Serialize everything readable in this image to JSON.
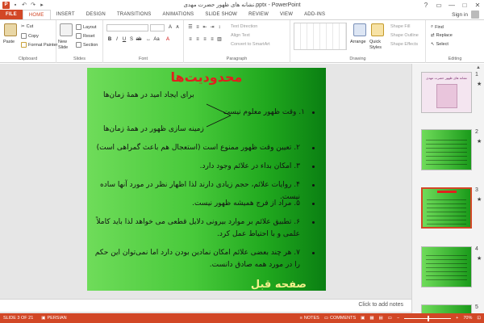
{
  "window": {
    "title": "نشانه های ظهور حضرت مهدی.pptx - PowerPoint",
    "controls": [
      "?",
      "▭",
      "—",
      "□",
      "✕"
    ]
  },
  "tabs": [
    {
      "label": "FILE"
    },
    {
      "label": "HOME"
    },
    {
      "label": "INSERT"
    },
    {
      "label": "DESIGN"
    },
    {
      "label": "TRANSITIONS"
    },
    {
      "label": "ANIMATIONS"
    },
    {
      "label": "SLIDE SHOW"
    },
    {
      "label": "REVIEW"
    },
    {
      "label": "VIEW"
    },
    {
      "label": "ADD-INS"
    }
  ],
  "user": {
    "name": "Sign in"
  },
  "ribbon": {
    "clipboard": {
      "label": "Clipboard",
      "paste": "Paste",
      "cut": "Cut",
      "copy": "Copy",
      "format_painter": "Format Painter"
    },
    "slides": {
      "label": "Slides",
      "new_slide": "New Slide",
      "layout": "Layout",
      "reset": "Reset",
      "section": "Section"
    },
    "font": {
      "label": "Font"
    },
    "paragraph": {
      "label": "Paragraph",
      "text_direction": "Text Direction",
      "align_text": "Align Text",
      "convert": "Convert to SmartArt"
    },
    "drawing": {
      "label": "Drawing",
      "arrange": "Arrange",
      "quick_styles": "Quick Styles",
      "shape_fill": "Shape Fill",
      "shape_outline": "Shape Outline",
      "shape_effects": "Shape Effects"
    },
    "editing": {
      "label": "Editing",
      "find": "Find",
      "replace": "Replace",
      "select": "Select"
    }
  },
  "slide": {
    "title": "محدودیت‌ها",
    "items": [
      {
        "num": "۱.",
        "text": "وقت ظهور معلوم نیست"
      },
      {
        "num": "۲.",
        "text": "تعیین وقت ظهور ممنوع است (استعجال هم باعث گمراهی است)"
      },
      {
        "num": "۳.",
        "text": "امکان بداء در علائم وجود دارد."
      },
      {
        "num": "۴.",
        "text": "روایات علائم، حجم زیادی دارند لذا اظهار نظر در مورد آنها ساده نیست."
      },
      {
        "num": "۵.",
        "text": "مراد از فرج همیشه ظهور نیست."
      },
      {
        "num": "۶.",
        "text": "تطبیق علائم بر موارد بیرونی دلایل قطعی می خواهد لذا باید کاملاً علمی و با احتیاط عمل کرد."
      },
      {
        "num": "۷.",
        "text": "هر چند بعضی علائم امکان نمادین بودن دارد اما نمی‌توان این حکم را در مورد همه صادق دانست."
      }
    ],
    "branch_top": "برای ایجاد امید در همهٔ زمان‌ها",
    "branch_bottom": "زمینه سازی ظهور در همهٔ زمان‌ها",
    "footer": "صفحه قبل"
  },
  "notes": {
    "placeholder": "Click to add notes"
  },
  "thumbnails": [
    {
      "num": "1",
      "title": "نشانه های ظهور حضرت مهدی",
      "bg": "#f4e5f0"
    },
    {
      "num": "2",
      "bg": "#3cc02a"
    },
    {
      "num": "3",
      "bg": "#3cc02a",
      "selected": true
    },
    {
      "num": "4",
      "bg": "#3cc02a"
    },
    {
      "num": "5",
      "bg": "#3cc02a"
    }
  ],
  "status": {
    "slide_info": "SLIDE 3 OF 21",
    "language": "PERSIAN",
    "notes": "NOTES",
    "comments": "COMMENTS",
    "zoom": "70%"
  },
  "colors": {
    "accent": "#d24726",
    "slide_title": "#e0201e",
    "footer_text": "#f5f08c"
  }
}
